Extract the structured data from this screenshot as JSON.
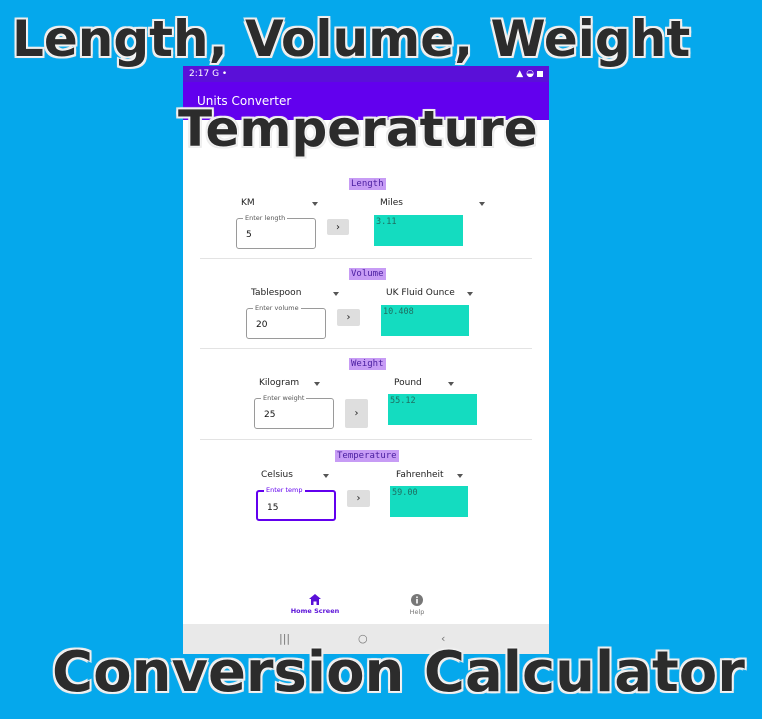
{
  "promo": {
    "top": "Length, Volume, Weight",
    "middle": "Temperature",
    "bottom": "Conversion Calculator"
  },
  "status_bar": {
    "time": "2:17",
    "left_icons": "G •"
  },
  "app_bar": {
    "title": "Units Converter"
  },
  "sections": {
    "length": {
      "title": "Length",
      "from_unit": "KM",
      "to_unit": "Miles",
      "input_label": "Enter length",
      "input_value": "5",
      "result": "3.11"
    },
    "volume": {
      "title": "Volume",
      "from_unit": "Tablespoon",
      "to_unit": "UK Fluid Ounce",
      "input_label": "Enter volume",
      "input_value": "20",
      "result": "10.408"
    },
    "weight": {
      "title": "Weight",
      "from_unit": "Kilogram",
      "to_unit": "Pound",
      "input_label": "Enter weight",
      "input_value": "25",
      "result": "55.12"
    },
    "temperature": {
      "title": "Temperature",
      "from_unit": "Celsius",
      "to_unit": "Fahrenheit",
      "input_label": "Enter temp",
      "input_value": "15",
      "result": "59.00"
    }
  },
  "convert_label": "›",
  "bottom_nav": {
    "home_label": "Home Screen",
    "help_label": "Help"
  },
  "system_nav": {
    "recents": "|||",
    "home": "○",
    "back": "‹"
  },
  "colors": {
    "background": "#05a8ec",
    "app_bar": "#6200ee",
    "result_fill": "#14dcc0",
    "title_highlight": "#c79cf5"
  }
}
